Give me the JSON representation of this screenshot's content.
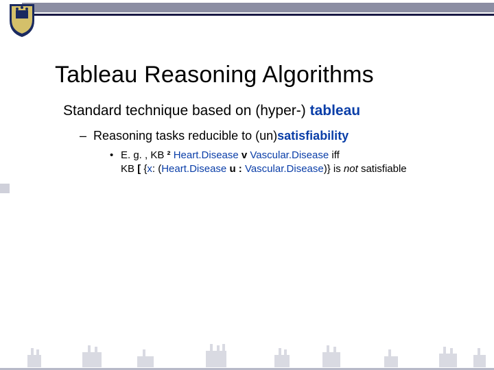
{
  "title": "Tableau Reasoning Algorithms",
  "line1_pre": "Standard technique based on (hyper-) ",
  "line1_key": "tableau",
  "bullet1_pre": "Reasoning tasks reducible to (un)",
  "bullet1_key": "satisfiability",
  "eg": "E. g. , KB ",
  "sym1": "²",
  "cond1": " Heart.Disease ",
  "vee": "v",
  "cond2": " Vascular.Disease ",
  "iff": "iff",
  "kb": "KB ",
  "lbr": "[ ",
  "lcb": "{",
  "x": "x",
  "colon1": ": ",
  "lp": "(",
  "hd": "Heart.Disease ",
  "u": "u",
  "neg": " : ",
  "vd": "Vascular.Disease",
  "rp": ")",
  "rcb": "}",
  "isnot": " is ",
  "not": "not",
  "sat": " satisfiable",
  "dash": "–",
  "dot": "•"
}
